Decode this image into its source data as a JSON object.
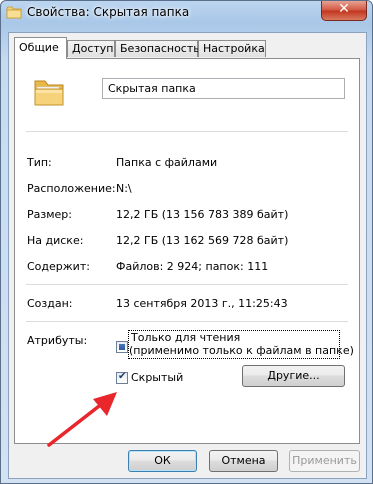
{
  "window": {
    "title": "Свойства: Скрытая папка",
    "close_glyph": "✕"
  },
  "tabs": [
    {
      "label": "Общие",
      "active": true
    },
    {
      "label": "Доступ"
    },
    {
      "label": "Безопасность"
    },
    {
      "label": "Настройка"
    }
  ],
  "general": {
    "name_value": "Скрытая папка",
    "info": [
      {
        "label": "Тип:",
        "value": "Папка с файлами"
      },
      {
        "label": "Расположение:",
        "value": "N:\\"
      },
      {
        "label": "Размер:",
        "value": "12,2 ГБ (13 156 783 389 байт)"
      },
      {
        "label": "На диске:",
        "value": "12,2 ГБ (13 162 569 728 байт)"
      },
      {
        "label": "Содержит:",
        "value": "Файлов: 2 924; папок: 111"
      }
    ],
    "created": {
      "label": "Создан:",
      "value": "13 сентября 2013 г., 11:25:43"
    },
    "attributes_label": "Атрибуты:",
    "readonly": {
      "line1": "Только для чтения",
      "line2": "(применимо только к файлам в папке)",
      "state": "indeterminate"
    },
    "hidden": {
      "label": "Скрытый",
      "checked": true
    },
    "other_button": "Другие..."
  },
  "buttons": {
    "ok": "ОК",
    "cancel": "Отмена",
    "apply": "Применить"
  },
  "colors": {
    "arrow": "#e8262b"
  }
}
